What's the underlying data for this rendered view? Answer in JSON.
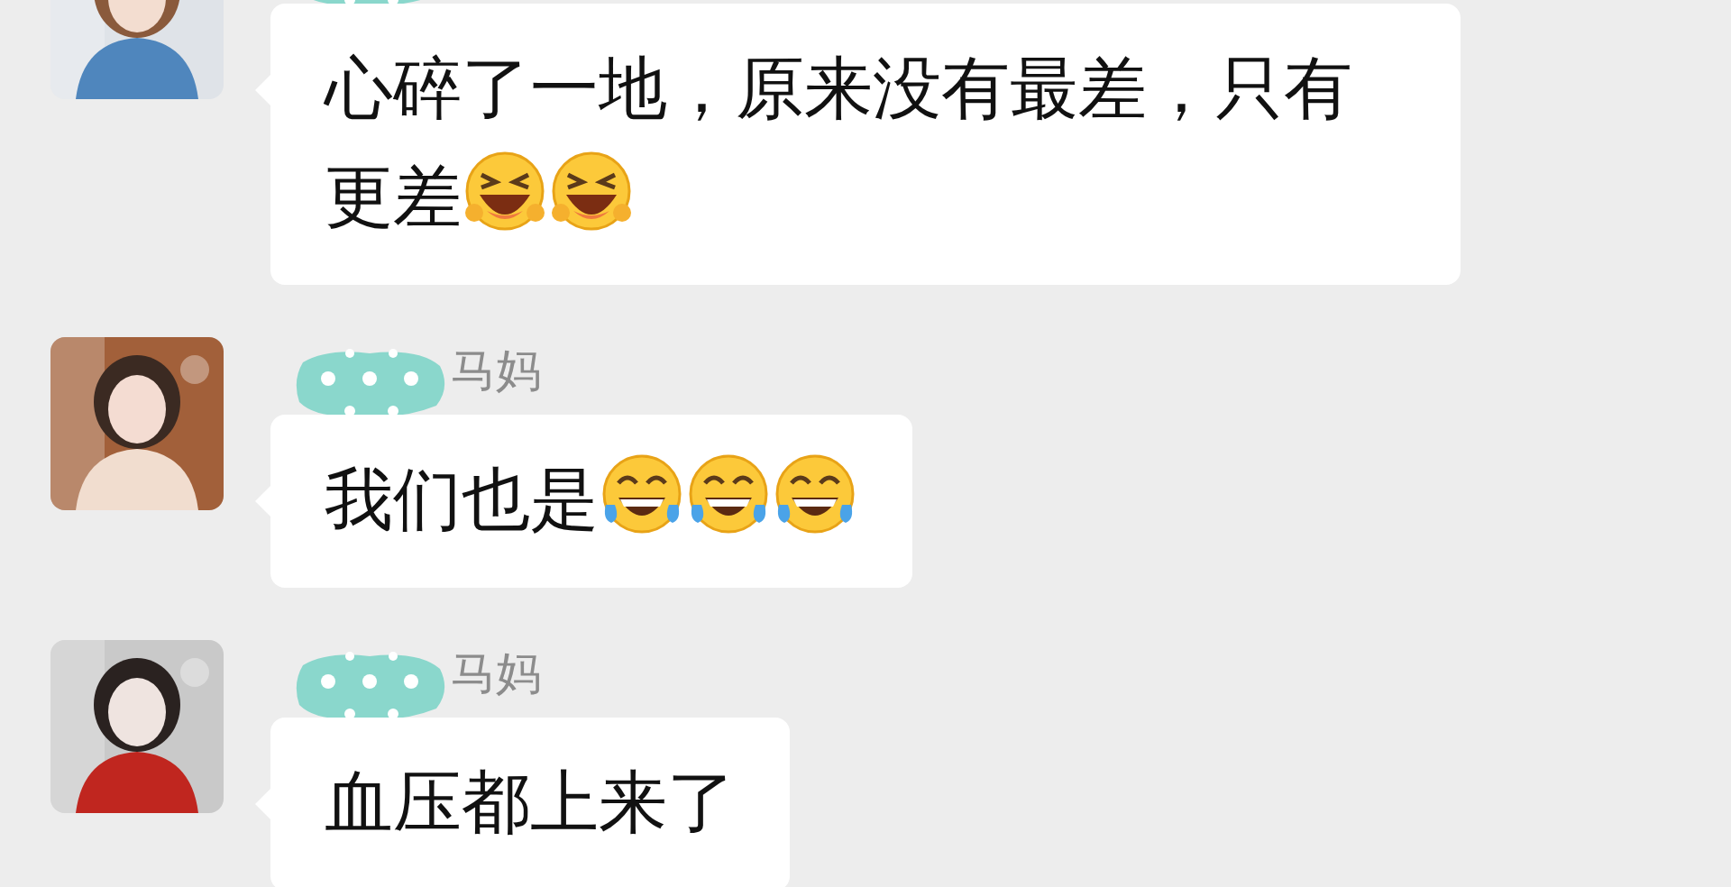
{
  "messages": [
    {
      "name_redacted": true,
      "avatar": {
        "kind": "picture"
      },
      "text": "心碎了一地，原来没有最差，只有更差",
      "emojis": [
        {
          "kind": "squint_laugh"
        },
        {
          "kind": "squint_laugh"
        }
      ]
    },
    {
      "name": "马妈",
      "name_redacted": true,
      "avatar": {
        "kind": "picture"
      },
      "text": "我们也是",
      "emojis": [
        {
          "kind": "tears_of_joy"
        },
        {
          "kind": "tears_of_joy"
        },
        {
          "kind": "tears_of_joy"
        }
      ]
    },
    {
      "name": "马妈",
      "name_redacted": true,
      "avatar": {
        "kind": "picture"
      },
      "text": "血压都上来了"
    }
  ]
}
